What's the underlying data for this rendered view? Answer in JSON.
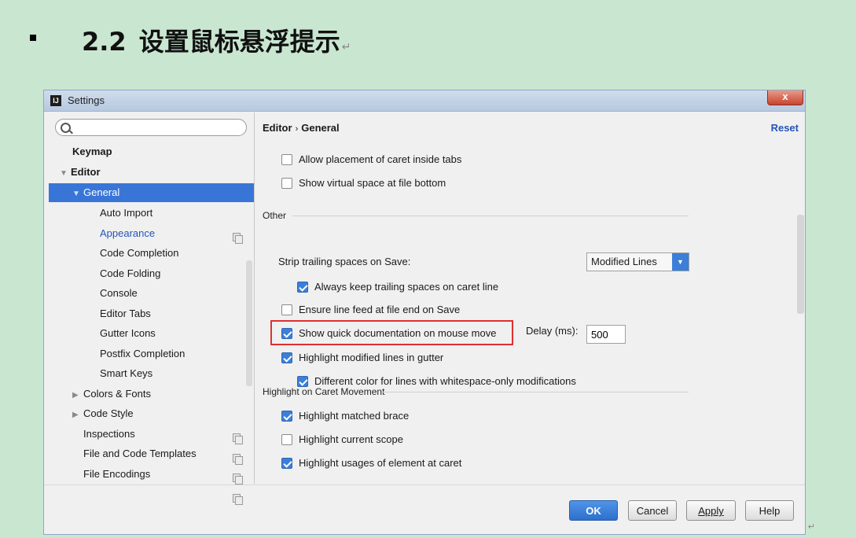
{
  "slide": {
    "number": "2.2",
    "title": "设置鼠标悬浮提示",
    "para_mark": "↵"
  },
  "dialog": {
    "title": "Settings",
    "app_icon": "IJ",
    "close_label": "x"
  },
  "sidebar": {
    "search_placeholder": "",
    "items": [
      {
        "label": "Keymap"
      },
      {
        "label": "Editor"
      },
      {
        "label": "General"
      },
      {
        "label": "Auto Import"
      },
      {
        "label": "Appearance"
      },
      {
        "label": "Code Completion"
      },
      {
        "label": "Code Folding"
      },
      {
        "label": "Console"
      },
      {
        "label": "Editor Tabs"
      },
      {
        "label": "Gutter Icons"
      },
      {
        "label": "Postfix Completion"
      },
      {
        "label": "Smart Keys"
      },
      {
        "label": "Colors & Fonts"
      },
      {
        "label": "Code Style"
      },
      {
        "label": "Inspections"
      },
      {
        "label": "File and Code Templates"
      },
      {
        "label": "File Encodings"
      }
    ]
  },
  "content": {
    "breadcrumb_parent": "Editor",
    "breadcrumb_sep": "›",
    "breadcrumb_current": "General",
    "reset_label": "Reset",
    "options_top": [
      {
        "label": "Allow placement of caret inside tabs",
        "checked": false
      },
      {
        "label": "Show virtual space at file bottom",
        "checked": false
      }
    ],
    "section_other": "Other",
    "strip_label": "Strip trailing spaces on Save:",
    "strip_value": "Modified Lines",
    "always_keep": {
      "label": "Always keep trailing spaces on caret line",
      "checked": true
    },
    "ensure_lf": {
      "label": "Ensure line feed at file end on Save",
      "checked": false
    },
    "quick_doc": {
      "label": "Show quick documentation on mouse move",
      "checked": true
    },
    "delay_label": "Delay (ms):",
    "delay_value": "500",
    "highlight_modified": {
      "label": "Highlight modified lines in gutter",
      "checked": true
    },
    "different_color": {
      "label": "Different color for lines with whitespace-only modifications",
      "checked": true
    },
    "section_caret": "Highlight on Caret Movement",
    "caret_options": [
      {
        "label": "Highlight matched brace",
        "checked": true
      },
      {
        "label": "Highlight current scope",
        "checked": false
      },
      {
        "label": "Highlight usages of element at caret",
        "checked": true
      }
    ]
  },
  "footer": {
    "ok": "OK",
    "cancel": "Cancel",
    "apply": "Apply",
    "help": "Help"
  },
  "colors": {
    "selection": "#3875d7",
    "link": "#2455b7",
    "highlight_box": "#e03030",
    "slide_bg": "#c9e6d1"
  }
}
